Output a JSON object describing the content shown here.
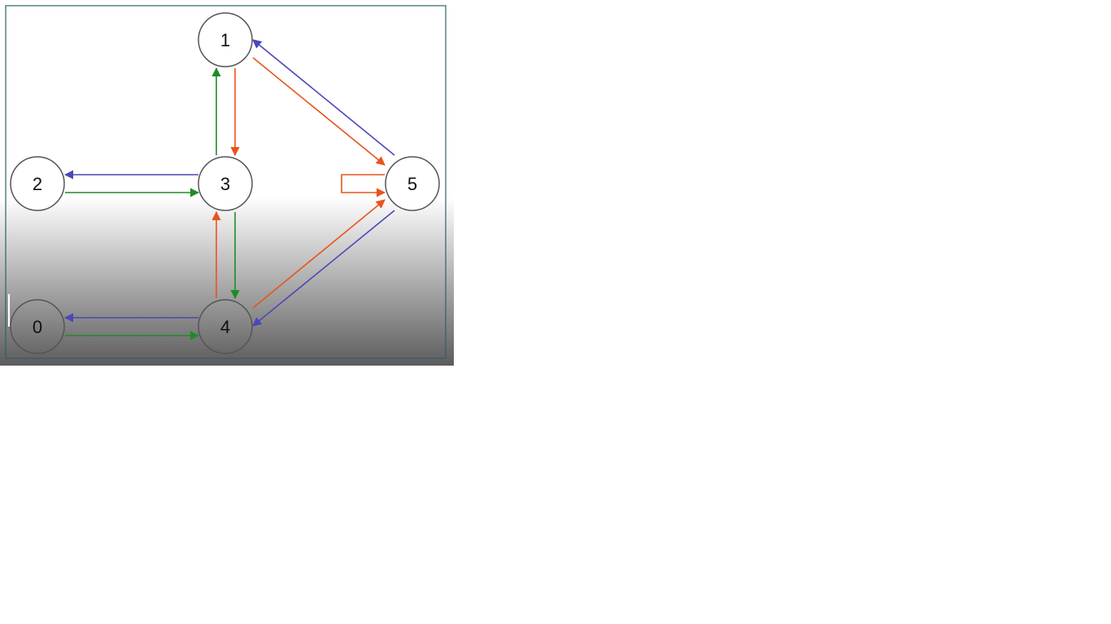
{
  "colors": {
    "red_edge": "#e8541c",
    "blue_edge": "#4b47b8",
    "green_edge": "#1f8a2a",
    "frame_border": "#2f5f6f",
    "node_fill": "#ffffff",
    "node_stroke": "#555555",
    "gradient_top": "#ffffff",
    "gradient_bottom": "#5c5c5c"
  },
  "nodes": [
    {
      "id": "1",
      "label": "1"
    },
    {
      "id": "2",
      "label": "2"
    },
    {
      "id": "3",
      "label": "3"
    },
    {
      "id": "5",
      "label": "5"
    },
    {
      "id": "0",
      "label": "0"
    },
    {
      "id": "4",
      "label": "4"
    }
  ],
  "edges": [
    {
      "from": "1",
      "to": "3",
      "color": "red"
    },
    {
      "from": "3",
      "to": "1",
      "color": "green"
    },
    {
      "from": "1",
      "to": "5",
      "color": "red"
    },
    {
      "from": "5",
      "to": "1",
      "color": "blue"
    },
    {
      "from": "3",
      "to": "2",
      "color": "blue"
    },
    {
      "from": "2",
      "to": "3",
      "color": "green"
    },
    {
      "from": "3",
      "to": "4",
      "color": "green"
    },
    {
      "from": "4",
      "to": "3",
      "color": "red"
    },
    {
      "from": "4",
      "to": "0",
      "color": "blue"
    },
    {
      "from": "0",
      "to": "4",
      "color": "green"
    },
    {
      "from": "4",
      "to": "5",
      "color": "red"
    },
    {
      "from": "5",
      "to": "4",
      "color": "blue"
    },
    {
      "from": "5",
      "to": "5",
      "color": "red"
    }
  ]
}
